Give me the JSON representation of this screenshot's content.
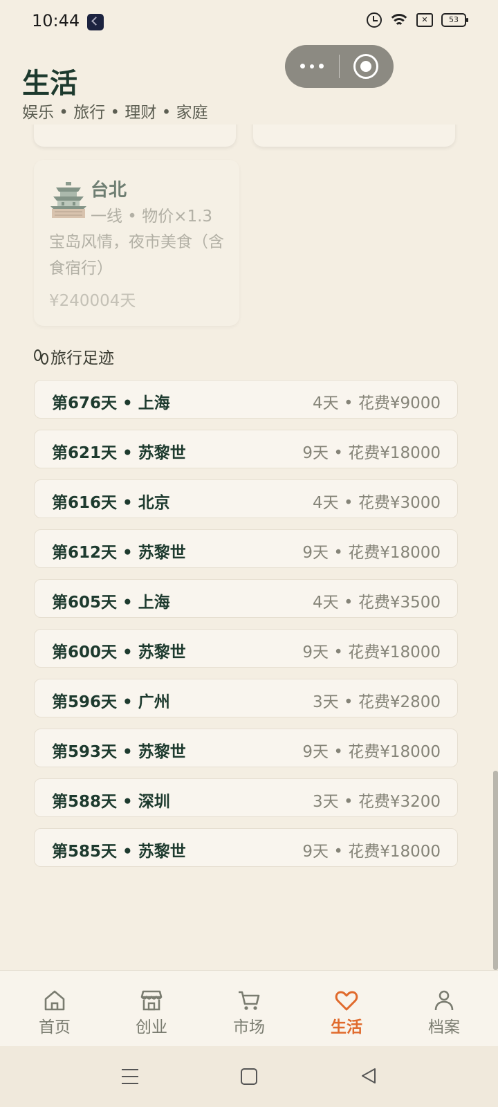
{
  "status_bar": {
    "time": "10:44",
    "battery": "53"
  },
  "header": {
    "title": "生活",
    "subtitle": "娱乐 • 旅行 • 理财 • 家庭"
  },
  "city_card": {
    "name": "台北",
    "meta": "一线 • 物价×1.3",
    "desc": "宝岛风情，夜市美食（含食宿行）",
    "price": "¥240004天"
  },
  "travel": {
    "section_title": "旅行足迹",
    "trips": [
      {
        "left": "第676天 • 上海",
        "right": "4天 • 花费¥9000"
      },
      {
        "left": "第621天 • 苏黎世",
        "right": "9天 • 花费¥18000"
      },
      {
        "left": "第616天 • 北京",
        "right": "4天 • 花费¥3000"
      },
      {
        "left": "第612天 • 苏黎世",
        "right": "9天 • 花费¥18000"
      },
      {
        "left": "第605天 • 上海",
        "right": "4天 • 花费¥3500"
      },
      {
        "left": "第600天 • 苏黎世",
        "right": "9天 • 花费¥18000"
      },
      {
        "left": "第596天 • 广州",
        "right": "3天 • 花费¥2800"
      },
      {
        "left": "第593天 • 苏黎世",
        "right": "9天 • 花费¥18000"
      },
      {
        "left": "第588天 • 深圳",
        "right": "3天 • 花费¥3200"
      },
      {
        "left": "第585天 • 苏黎世",
        "right": "9天 • 花费¥18000"
      }
    ]
  },
  "tabbar": {
    "tabs": [
      {
        "label": "首页",
        "icon": "home-icon"
      },
      {
        "label": "创业",
        "icon": "shop-icon"
      },
      {
        "label": "市场",
        "icon": "cart-icon"
      },
      {
        "label": "生活",
        "icon": "heart-icon"
      },
      {
        "label": "档案",
        "icon": "person-icon"
      }
    ],
    "active_index": 3
  },
  "colors": {
    "accent": "#e06a2c",
    "primary_text": "#1d3a2e",
    "background": "#f4eee2"
  }
}
